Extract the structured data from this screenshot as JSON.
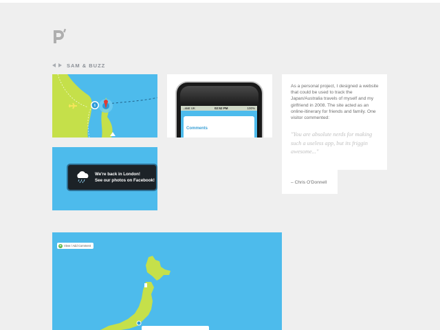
{
  "header": {
    "logo_alt": "p",
    "project_title": "SAM & BUZZ"
  },
  "nav": {
    "prev_icon": "triangle-left-icon",
    "next_icon": "triangle-right-icon"
  },
  "tiles": {
    "phone": {
      "carrier": "..at&t UK",
      "time": "02:52 PM",
      "battery": "100%",
      "heading": "Comments"
    },
    "notice": {
      "icon": "rain-cloud-icon",
      "line1": "We're back in London!",
      "line2": "See our photos on Facebook!"
    },
    "map": {
      "button_label": "View / Add Comment"
    }
  },
  "description": {
    "body": "As a personal project, I designed a website that could be used to track the Japan/Australia travels of myself and my girlfriend in 2008. The site acted as an online-itinerary for friends and family. One visitor commented:",
    "quote": "\"You are absolute nerds for making such a useless app, but its friggin awesome...\"",
    "credit": "– Chris O'Donnell"
  },
  "colors": {
    "background": "#efefef",
    "sky_blue": "#4dbbec",
    "land_green": "#c5e04a",
    "text_grey": "#6e6e6e",
    "quote_grey": "#c0c0c0"
  }
}
